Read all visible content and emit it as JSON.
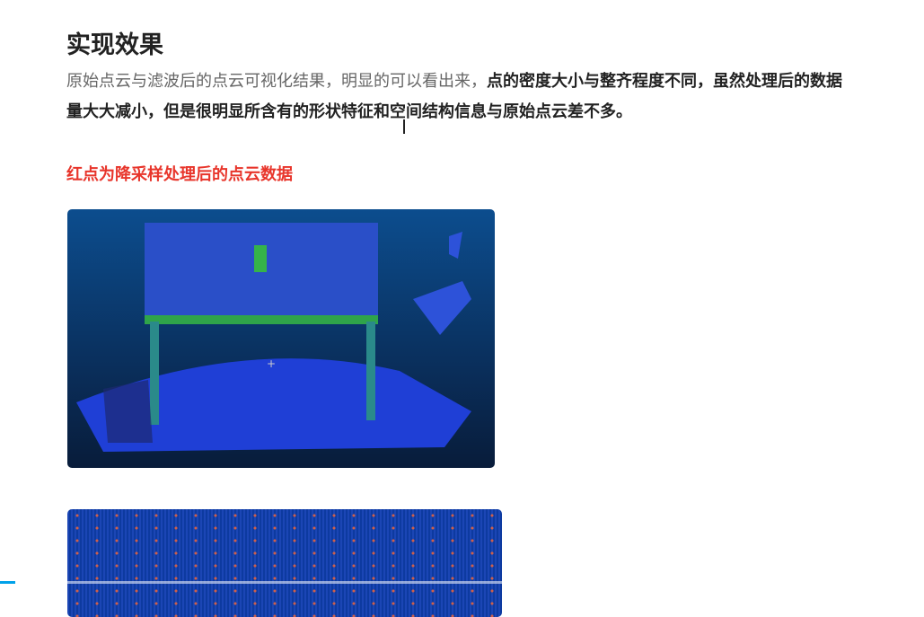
{
  "article": {
    "title": "实现效果",
    "paragraph_plain": "原始点云与滤波后的点云可视化结果，明显的可以看出来，",
    "paragraph_bold": "点的密度大小与整齐程度不同，虽然处理后的数据量大大减小，但是很明显所含有的形状特征和空间结构信息与原始点云差不多。",
    "note": "红点为降采样处理后的点云数据",
    "note_color": "#e8352b"
  },
  "video": {
    "progress_percent": 1.7,
    "accent": "#00a1e9"
  }
}
